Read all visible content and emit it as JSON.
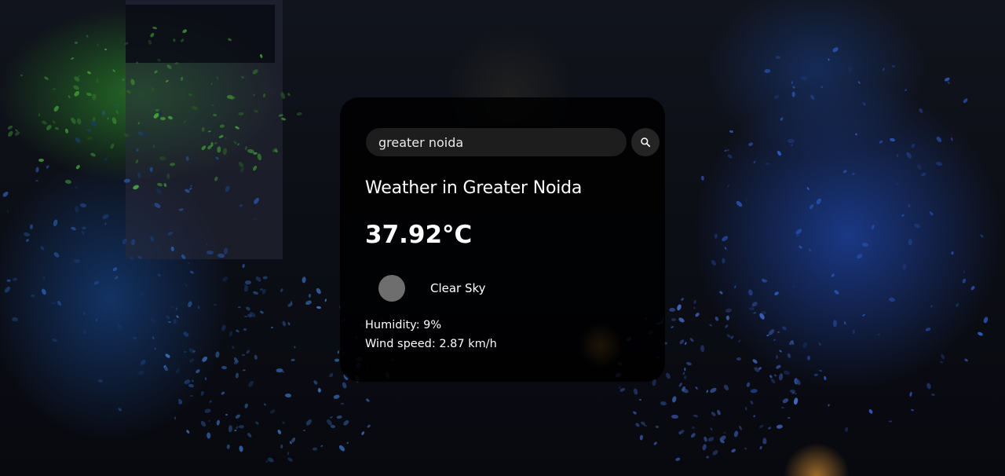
{
  "search": {
    "value": "greater noida",
    "icon": "search-icon"
  },
  "weather": {
    "title": "Weather in Greater Noida",
    "temperature": "37.92°C",
    "icon": "weather-condition-icon",
    "description": "Clear Sky",
    "humidity": "Humidity: 9%",
    "wind": "Wind speed: 2.87 km/h"
  }
}
